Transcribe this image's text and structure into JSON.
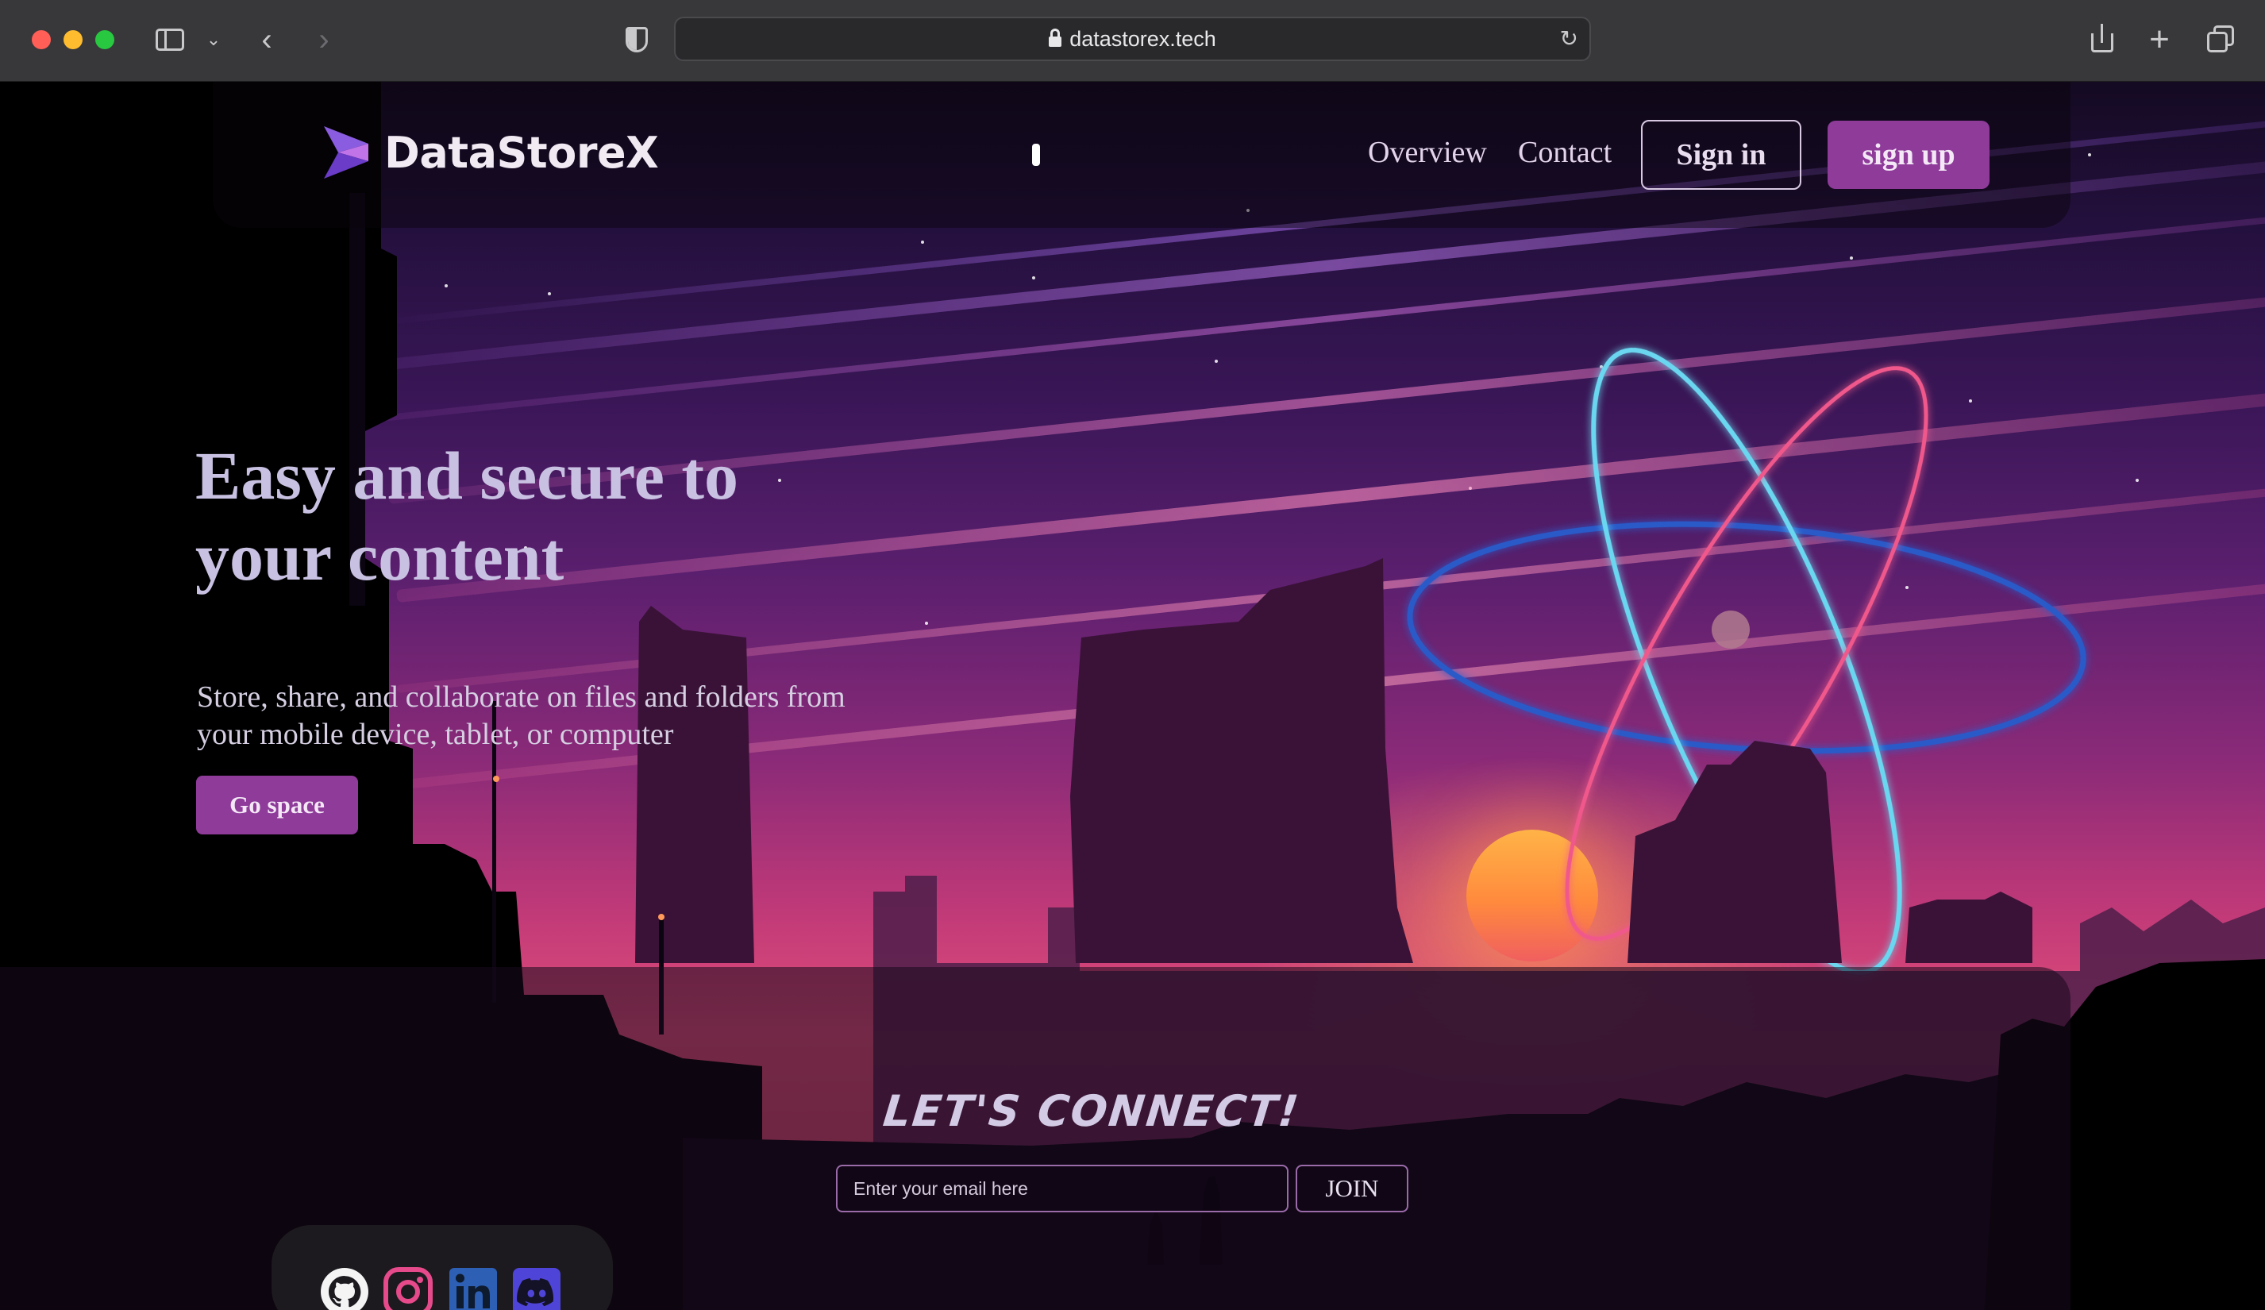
{
  "browser": {
    "url": "datastorex.tech"
  },
  "nav": {
    "brand": "DataStoreX",
    "links": [
      "Overview",
      "Contact"
    ],
    "signin_label": "Sign in",
    "signup_label": "sign up"
  },
  "hero": {
    "title": "Easy and secure to your content",
    "subtitle": "Store, share, and collaborate on files and folders from your mobile device, tablet, or computer",
    "cta_label": "Go space"
  },
  "newsletter": {
    "title": "Let's connect!",
    "email_placeholder": "Enter your email here",
    "join_label": "JOIN"
  },
  "social": {
    "icons": [
      "github-icon",
      "instagram-icon",
      "linkedin-icon",
      "discord-icon"
    ]
  },
  "colors": {
    "accent": "#8e3b9a",
    "sky_top": "#140a22",
    "sky_horizon": "#e2507a",
    "orbit_cyan": "#6ad6ef",
    "orbit_pink": "#f0588c",
    "orbit_blue": "#2a5ac8"
  }
}
